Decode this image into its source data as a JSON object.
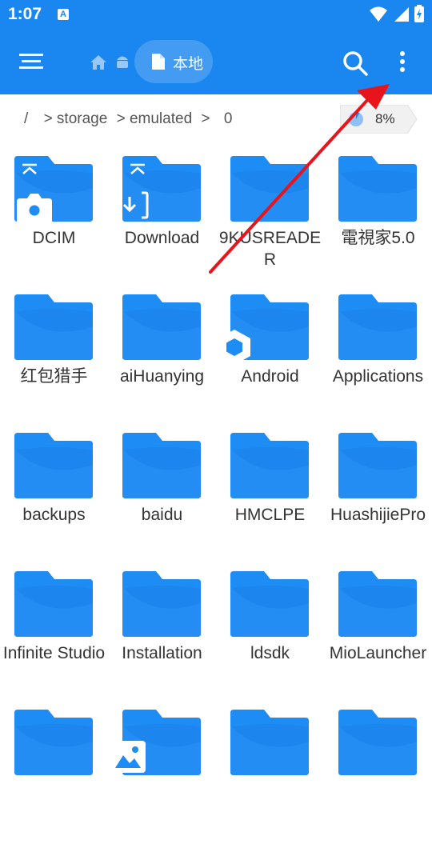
{
  "status_bar": {
    "time": "1:07",
    "notification_icon": "A"
  },
  "toolbar": {
    "menu_icon": "hamburger-menu-icon",
    "home_icon": "home-icon",
    "android_icon": "android-icon",
    "location_label": "本地",
    "search_icon": "search-icon",
    "more_icon": "more-vertical-icon"
  },
  "path": {
    "segments": [
      "/",
      "> storage",
      "> emulated",
      ">",
      "0"
    ]
  },
  "storage": {
    "percent": "8%",
    "used_fraction": 0.08
  },
  "folders": [
    {
      "name": "DCIM",
      "badge": "camera"
    },
    {
      "name": "Download",
      "badge": "download"
    },
    {
      "name": "9KUSREADER"
    },
    {
      "name": "電視家5.0"
    },
    {
      "name": "红包猎手"
    },
    {
      "name": "aiHuanying"
    },
    {
      "name": "Android",
      "badge": "hexagon"
    },
    {
      "name": "Applications"
    },
    {
      "name": "backups"
    },
    {
      "name": "baidu"
    },
    {
      "name": "HMCLPE"
    },
    {
      "name": "HuashijiePro"
    },
    {
      "name": "Infinite Studio"
    },
    {
      "name": "Installation"
    },
    {
      "name": "ldsdk"
    },
    {
      "name": "MioLauncher"
    },
    {
      "name": ""
    },
    {
      "name": "",
      "badge": "image"
    },
    {
      "name": ""
    },
    {
      "name": ""
    }
  ],
  "colors": {
    "accent": "#1a86f0",
    "folder": "#1e8cf5",
    "annotation_arrow": "#e8141c"
  }
}
